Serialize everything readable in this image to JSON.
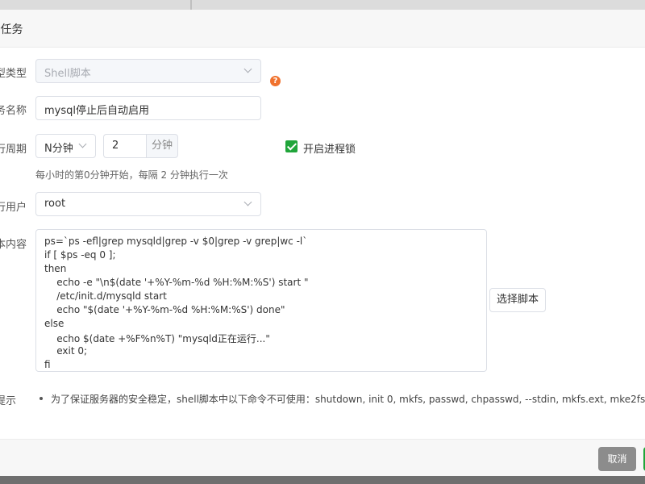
{
  "modal": {
    "title": "·任务"
  },
  "form": {
    "task_type": {
      "label": "型类型",
      "value": "Shell脚本",
      "help": "?"
    },
    "task_name": {
      "label": "务名称",
      "value": "mysql停止后自动启用"
    },
    "period": {
      "label": "行周期",
      "unit_select": "N分钟",
      "number": "2",
      "number_unit": "分钟",
      "hint": "每小时的第0分钟开始，每隔 2 分钟执行一次"
    },
    "process_lock": {
      "label": "开启进程锁",
      "checked": true
    },
    "user": {
      "label": "行用户",
      "value": "root"
    },
    "script": {
      "label": "本内容",
      "lines": [
        "ps=`ps -efl|grep mysqld|grep -v $0|grep -v grep|wc -l`",
        "if [ $ps -eq 0 ];",
        "then",
        "    echo -e \"\\n$(date '+%Y-%m-%d %H:%M:%S') start \"",
        "    /etc/init.d/mysqld start",
        "    echo \"$(date '+%Y-%m-%d %H:%M:%S') done\"",
        "else",
        "    echo $(date +%F%n%T) \"mysqld正在运行...\"",
        "    exit 0;",
        "fi"
      ],
      "select_button": "选择脚本"
    },
    "tips": {
      "label": "提示",
      "text": "为了保证服务器的安全稳定，shell脚本中以下命令不可使用：shutdown, init 0, mkfs, passwd, chpasswd, --stdin, mkfs.ext, mke2fs"
    }
  },
  "footer": {
    "cancel": "取消"
  },
  "colors": {
    "accent_green": "#20a53a",
    "help_orange": "#f0722e",
    "cancel_gray": "#8c8c8c"
  }
}
